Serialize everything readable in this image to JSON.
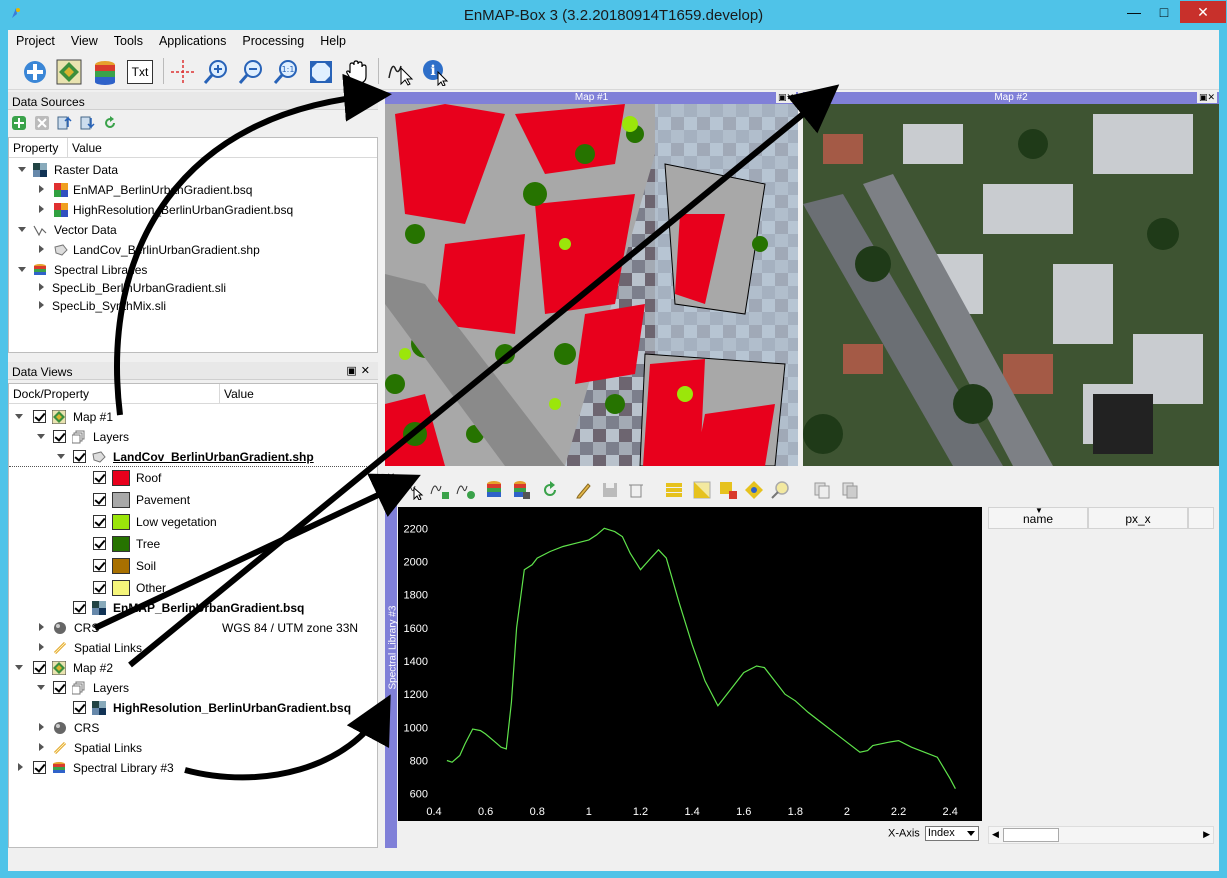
{
  "window": {
    "title": "EnMAP-Box 3 (3.2.20180914T1659.develop)"
  },
  "menu": [
    "Project",
    "View",
    "Tools",
    "Applications",
    "Processing",
    "Help"
  ],
  "toolbar": {
    "txt_label": "Txt",
    "tools": [
      "add-data-source",
      "create-map",
      "create-spectral-library",
      "create-text-view",
      "crosshair",
      "zoom-in",
      "zoom-out",
      "zoom-native",
      "zoom-full",
      "pan",
      "identify-profile",
      "identify-info"
    ]
  },
  "data_sources": {
    "title": "Data Sources",
    "columns": [
      "Property",
      "Value"
    ],
    "raster_label": "Raster Data",
    "rasters": [
      "EnMAP_BerlinUrbanGradient.bsq",
      "HighResolution_BerlinUrbanGradient.bsq"
    ],
    "vector_label": "Vector Data",
    "vectors": [
      "LandCov_BerlinUrbanGradient.shp"
    ],
    "speclib_label": "Spectral Libraries",
    "speclibs": [
      "SpecLib_BerlinUrbanGradient.sli",
      "SpecLib_SynthMix.sli"
    ]
  },
  "data_views": {
    "title": "Data Views",
    "columns": [
      "Dock/Property",
      "Value"
    ],
    "map1": "Map #1",
    "layers": "Layers",
    "vector_layer": "LandCov_BerlinUrbanGradient.shp",
    "classes": [
      {
        "name": "Roof",
        "color": "#e8001c"
      },
      {
        "name": "Pavement",
        "color": "#a8a8a8"
      },
      {
        "name": "Low vegetation",
        "color": "#9be60a"
      },
      {
        "name": "Tree",
        "color": "#267300"
      },
      {
        "name": "Soil",
        "color": "#a87000"
      },
      {
        "name": "Other",
        "color": "#f5f57a"
      }
    ],
    "raster_layer1": "EnMAP_BerlinUrbanGradient.bsq",
    "crs_label": "CRS",
    "crs_value": "WGS 84 / UTM zone 33N",
    "spatial_links": "Spatial Links",
    "map2": "Map #2",
    "raster_layer2": "HighResolution_BerlinUrbanGradient.bsq",
    "speclib": "Spectral Library #3"
  },
  "maps": {
    "map1_title": "Map #1",
    "map2_title": "Map #2"
  },
  "spectral_library": {
    "dock_title": "Spectral Library #3",
    "table_columns": [
      "name",
      "px_x"
    ],
    "xaxis_label": "X-Axis",
    "xaxis_value": "Index"
  },
  "chart_data": {
    "type": "line",
    "x_ticks": [
      "0.4",
      "0.6",
      "0.8",
      "1",
      "1.2",
      "1.4",
      "1.6",
      "1.8",
      "2",
      "2.2",
      "2.4"
    ],
    "y_ticks": [
      "600",
      "800",
      "1000",
      "1200",
      "1400",
      "1600",
      "1800",
      "2000",
      "2200"
    ],
    "xlim": [
      0.4,
      2.5
    ],
    "ylim": [
      580,
      2280
    ],
    "line_color": "#5fe34b",
    "background": "#000000",
    "series": [
      {
        "x": [
          0.45,
          0.47,
          0.5,
          0.52,
          0.55,
          0.58,
          0.6,
          0.63,
          0.66,
          0.68,
          0.7,
          0.72,
          0.75,
          0.78,
          0.8,
          0.85,
          0.9,
          0.95,
          1.0,
          1.03,
          1.06,
          1.08,
          1.1,
          1.13,
          1.16,
          1.2,
          1.24,
          1.27,
          1.3,
          1.35,
          1.4,
          1.45,
          1.5,
          1.52,
          1.55,
          1.6,
          1.65,
          1.68,
          1.72,
          1.76,
          1.8,
          1.85,
          1.9,
          1.95,
          2.0,
          2.05,
          2.08,
          2.1,
          2.13,
          2.16,
          2.2,
          2.25,
          2.3,
          2.35,
          2.4,
          2.42
        ],
        "y": [
          800,
          790,
          830,
          900,
          990,
          980,
          960,
          920,
          880,
          870,
          1150,
          1600,
          1950,
          1980,
          2020,
          2060,
          2090,
          2110,
          2130,
          2160,
          2200,
          2190,
          2180,
          2150,
          2050,
          1950,
          2020,
          2070,
          2020,
          1750,
          1500,
          1280,
          1130,
          1170,
          1230,
          1330,
          1370,
          1360,
          1280,
          1200,
          1160,
          1090,
          1030,
          970,
          910,
          850,
          860,
          890,
          900,
          910,
          920,
          880,
          850,
          820,
          690,
          630
        ]
      }
    ]
  }
}
